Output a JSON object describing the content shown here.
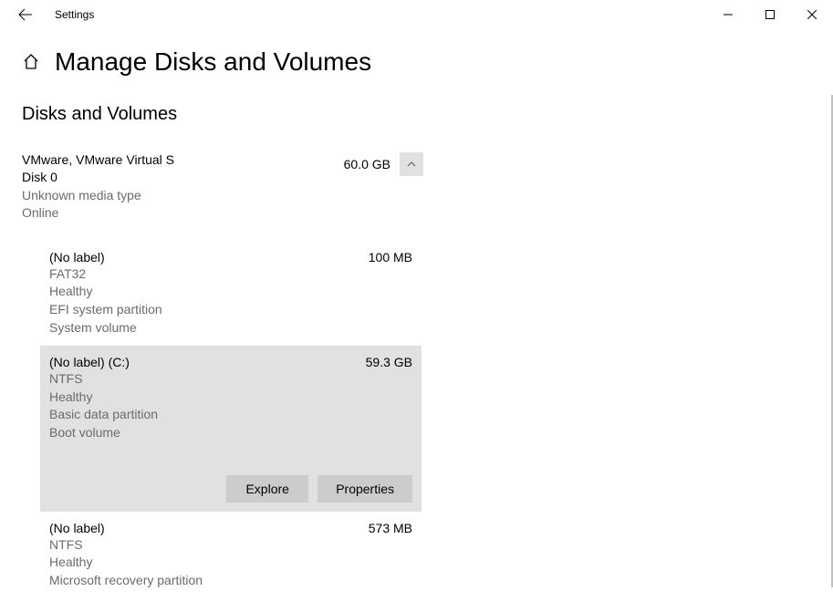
{
  "window": {
    "title": "Settings"
  },
  "page": {
    "title": "Manage Disks and Volumes",
    "section": "Disks and Volumes"
  },
  "disk": {
    "name": "VMware, VMware Virtual S",
    "size": "60.0 GB",
    "id": "Disk 0",
    "media": "Unknown media type",
    "status": "Online"
  },
  "volumes": [
    {
      "name": "(No label)",
      "size": "100 MB",
      "fs": "FAT32",
      "health": "Healthy",
      "ptype": "EFI system partition",
      "voltype": "System volume",
      "selected": false
    },
    {
      "name": "(No label) (C:)",
      "size": "59.3 GB",
      "fs": "NTFS",
      "health": "Healthy",
      "ptype": "Basic data partition",
      "voltype": "Boot volume",
      "selected": true
    },
    {
      "name": "(No label)",
      "size": "573 MB",
      "fs": "NTFS",
      "health": "Healthy",
      "ptype": "Microsoft recovery partition",
      "voltype": "",
      "selected": false
    }
  ],
  "actions": {
    "explore": "Explore",
    "properties": "Properties"
  }
}
